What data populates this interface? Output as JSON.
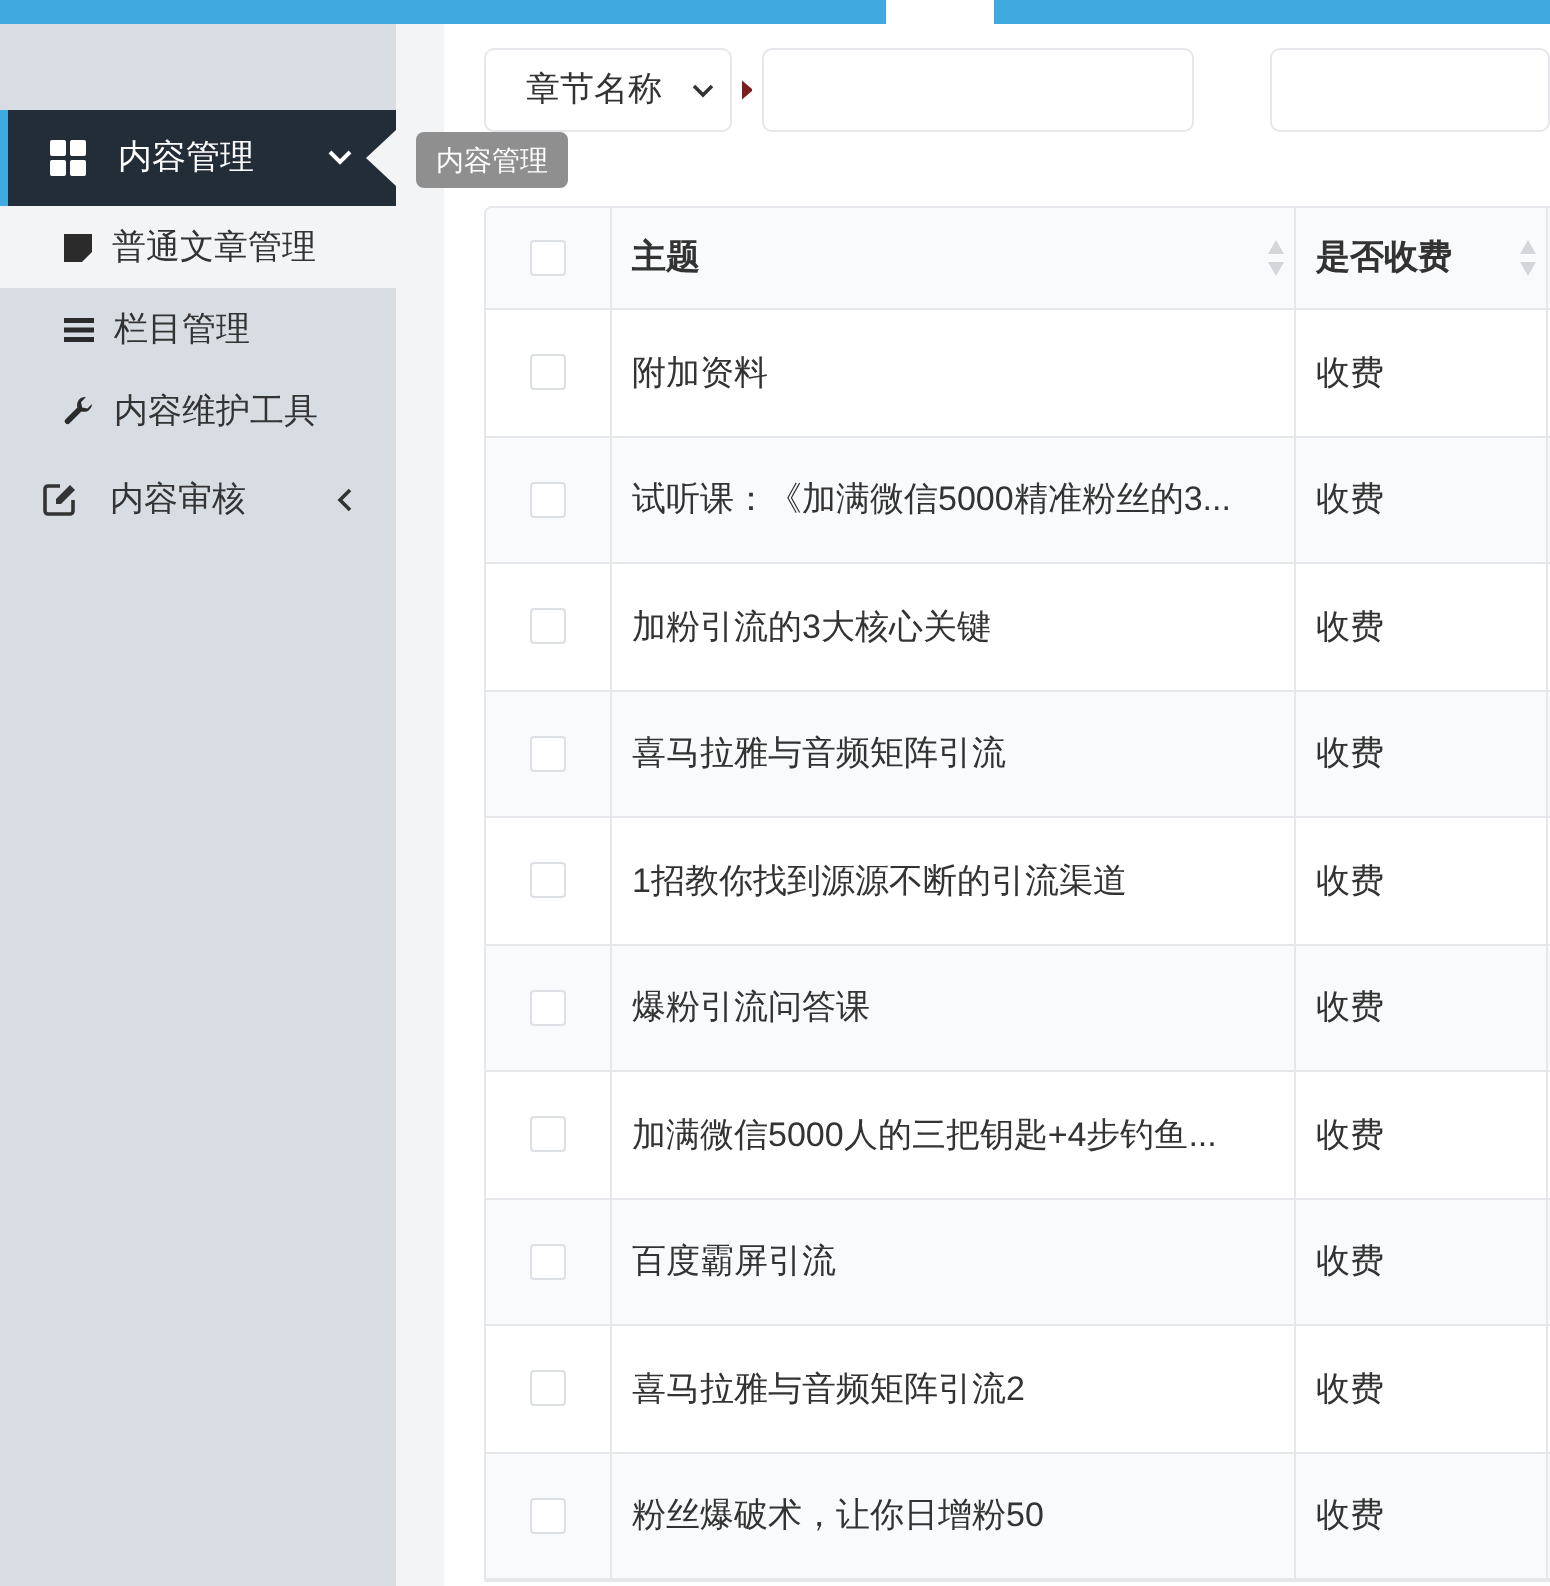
{
  "sidebar": {
    "items": [
      {
        "label": "内容管理",
        "expanded": true,
        "selected": true,
        "children": [
          {
            "label": "普通文章管理",
            "selected": true
          },
          {
            "label": "栏目管理",
            "selected": false
          },
          {
            "label": "内容维护工具",
            "selected": false
          }
        ]
      },
      {
        "label": "内容审核",
        "expanded": false,
        "selected": false
      }
    ]
  },
  "tooltip": {
    "text": "内容管理"
  },
  "filter": {
    "select": {
      "value": "章节名称"
    }
  },
  "table": {
    "select_all_checked": false,
    "columns": [
      {
        "label": "主题",
        "sortable": true
      },
      {
        "label": "是否收费",
        "sortable": true
      }
    ],
    "rows": [
      {
        "checked": false,
        "cells": [
          "附加资料",
          "收费"
        ]
      },
      {
        "checked": false,
        "cells": [
          "试听课：《加满微信5000精准粉丝的3...",
          "收费"
        ]
      },
      {
        "checked": false,
        "cells": [
          "加粉引流的3大核心关键",
          "收费"
        ]
      },
      {
        "checked": false,
        "cells": [
          "喜马拉雅与音频矩阵引流",
          "收费"
        ]
      },
      {
        "checked": false,
        "cells": [
          "1招教你找到源源不断的引流渠道",
          "收费"
        ]
      },
      {
        "checked": false,
        "cells": [
          "爆粉引流问答课",
          "收费"
        ]
      },
      {
        "checked": false,
        "cells": [
          "加满微信5000人的三把钥匙+4步钓鱼...",
          "收费"
        ]
      },
      {
        "checked": false,
        "cells": [
          "百度霸屏引流",
          "收费"
        ]
      },
      {
        "checked": false,
        "cells": [
          "喜马拉雅与音频矩阵引流2",
          "收费"
        ]
      },
      {
        "checked": false,
        "cells": [
          "粉丝爆破术，让你日增粉50",
          "收费"
        ]
      }
    ]
  }
}
